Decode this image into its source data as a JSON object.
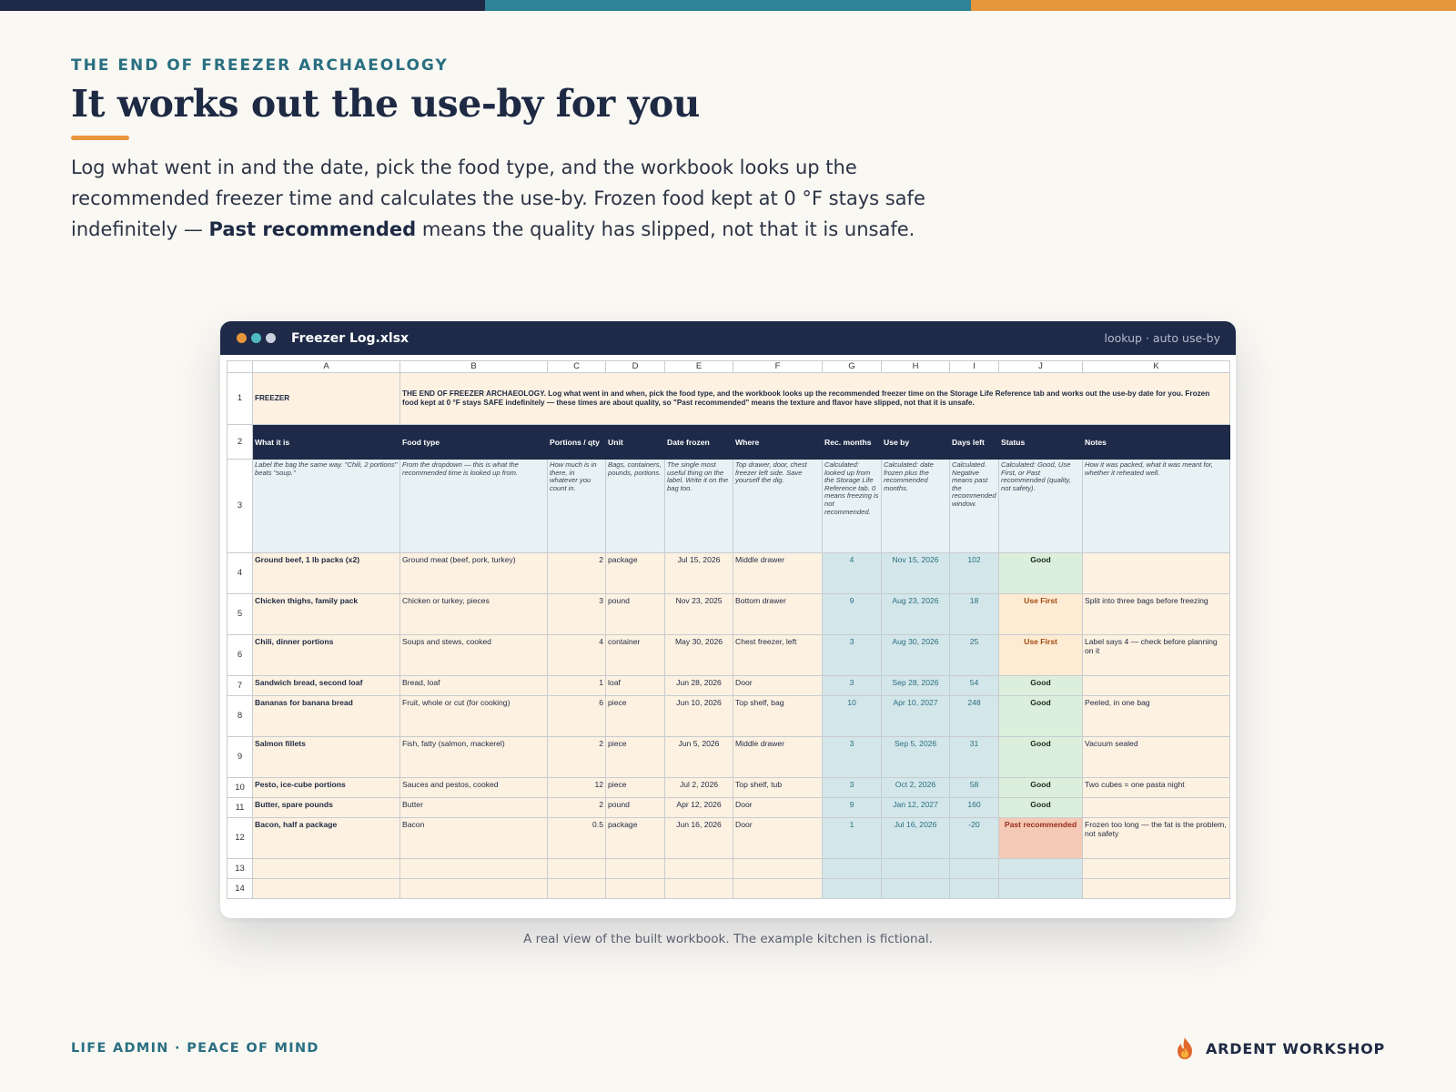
{
  "colors": {
    "navy": "#1e2a48",
    "teal": "#2a6f82",
    "orange": "#e8963c",
    "input_fill": "#fdf1e1",
    "calc_fill": "#d3e6e9",
    "good_fill": "#dcefdc",
    "use_first_fill": "#fdebd3",
    "past_fill": "#f4c9b6",
    "bg": "#faf8f3"
  },
  "eyebrow": "THE END OF FREEZER ARCHAEOLOGY",
  "headline": "It works out the use-by for you",
  "lede": {
    "part1": "Log what went in and the date, pick the food type, and the workbook looks up the recommended freezer time and calculates the use-by. Frozen food kept at 0 °F stays safe indefinitely — ",
    "bold": "Past recommended",
    "part2": " means the quality has slipped, not that it is unsafe."
  },
  "window": {
    "title": "Freezer Log.xlsx",
    "right_label": "lookup · auto use-by",
    "dots": [
      "#e8963c",
      "#4fb8c2",
      "#c9cfdc"
    ]
  },
  "sheet": {
    "columns": [
      "A",
      "B",
      "C",
      "D",
      "E",
      "F",
      "G",
      "H",
      "I",
      "J",
      "K"
    ],
    "row_numbers": [
      "1",
      "2",
      "3",
      "4",
      "5",
      "6",
      "7",
      "8",
      "9",
      "10",
      "11",
      "12",
      "13",
      "14"
    ],
    "title_cell": "FREEZER",
    "description": "THE END OF FREEZER ARCHAEOLOGY. Log what went in and when, pick the food type, and the workbook looks up the recommended freezer time on the Storage Life Reference tab and works out the use-by date for you. Frozen food kept at 0 °F stays SAFE indefinitely — these times are about quality, so \"Past recommended\" means the texture and flavor have slipped, not that it is unsafe.",
    "headers": [
      "What it is",
      "Food type",
      "Portions / qty",
      "Unit",
      "Date frozen",
      "Where",
      "Rec. months",
      "Use by",
      "Days left",
      "Status",
      "Notes"
    ],
    "hints": [
      "Label the bag the same way. \"Chili, 2 portions\" beats \"soup.\"",
      "From the dropdown — this is what the recommended time is looked up from.",
      "How much is in there, in whatever you count in.",
      "Bags, containers, pounds, portions.",
      "The single most useful thing on the label. Write it on the bag too.",
      "Top drawer, door, chest freezer left side. Save yourself the dig.",
      "Calculated: looked up from the Storage Life Reference tab. 0 means freezing is not recommended.",
      "Calculated: date frozen plus the recommended months.",
      "Calculated. Negative means past the recommended window.",
      "Calculated: Good, Use First, or Past recommended (quality, not safety).",
      "How it was packed, what it was meant for, whether it reheated well."
    ],
    "rows": [
      {
        "what": "Ground beef, 1 lb packs (x2)",
        "food_type": "Ground meat (beef, pork, turkey)",
        "qty": "2",
        "unit": "package",
        "date_frozen": "Jul 15, 2026",
        "where": "Middle drawer",
        "rec_months": "4",
        "use_by": "Nov 15, 2026",
        "days_left": "102",
        "status": "Good",
        "status_kind": "good",
        "notes": ""
      },
      {
        "what": "Chicken thighs, family pack",
        "food_type": "Chicken or turkey, pieces",
        "qty": "3",
        "unit": "pound",
        "date_frozen": "Nov 23, 2025",
        "where": "Bottom drawer",
        "rec_months": "9",
        "use_by": "Aug 23, 2026",
        "days_left": "18",
        "status": "Use First",
        "status_kind": "use",
        "notes": "Split into three bags before freezing"
      },
      {
        "what": "Chili, dinner portions",
        "food_type": "Soups and stews, cooked",
        "qty": "4",
        "unit": "container",
        "date_frozen": "May 30, 2026",
        "where": "Chest freezer, left",
        "rec_months": "3",
        "use_by": "Aug 30, 2026",
        "days_left": "25",
        "status": "Use First",
        "status_kind": "use",
        "notes": "Label says 4 — check before planning on it"
      },
      {
        "what": "Sandwich bread, second loaf",
        "food_type": "Bread, loaf",
        "qty": "1",
        "unit": "loaf",
        "date_frozen": "Jun 28, 2026",
        "where": "Door",
        "rec_months": "3",
        "use_by": "Sep 28, 2026",
        "days_left": "54",
        "status": "Good",
        "status_kind": "good",
        "notes": ""
      },
      {
        "what": "Bananas for banana bread",
        "food_type": "Fruit, whole or cut (for cooking)",
        "qty": "6",
        "unit": "piece",
        "date_frozen": "Jun 10, 2026",
        "where": "Top shelf, bag",
        "rec_months": "10",
        "use_by": "Apr 10, 2027",
        "days_left": "248",
        "status": "Good",
        "status_kind": "good",
        "notes": "Peeled, in one bag"
      },
      {
        "what": "Salmon fillets",
        "food_type": "Fish, fatty (salmon, mackerel)",
        "qty": "2",
        "unit": "piece",
        "date_frozen": "Jun 5, 2026",
        "where": "Middle drawer",
        "rec_months": "3",
        "use_by": "Sep 5, 2026",
        "days_left": "31",
        "status": "Good",
        "status_kind": "good",
        "notes": "Vacuum sealed"
      },
      {
        "what": "Pesto, ice-cube portions",
        "food_type": "Sauces and pestos, cooked",
        "qty": "12",
        "unit": "piece",
        "date_frozen": "Jul 2, 2026",
        "where": "Top shelf, tub",
        "rec_months": "3",
        "use_by": "Oct 2, 2026",
        "days_left": "58",
        "status": "Good",
        "status_kind": "good",
        "notes": "Two cubes = one pasta night"
      },
      {
        "what": "Butter, spare pounds",
        "food_type": "Butter",
        "qty": "2",
        "unit": "pound",
        "date_frozen": "Apr 12, 2026",
        "where": "Door",
        "rec_months": "9",
        "use_by": "Jan 12, 2027",
        "days_left": "160",
        "status": "Good",
        "status_kind": "good",
        "notes": ""
      },
      {
        "what": "Bacon, half a package",
        "food_type": "Bacon",
        "qty": "0.5",
        "unit": "package",
        "date_frozen": "Jun 16, 2026",
        "where": "Door",
        "rec_months": "1",
        "use_by": "Jul 16, 2026",
        "days_left": "-20",
        "status": "Past recommended",
        "status_kind": "past",
        "notes": "Frozen too long — the fat is the problem, not safety"
      },
      {
        "what": "",
        "food_type": "",
        "qty": "",
        "unit": "",
        "date_frozen": "",
        "where": "",
        "rec_months": "",
        "use_by": "",
        "days_left": "",
        "status": "",
        "status_kind": "empty",
        "notes": ""
      },
      {
        "what": "",
        "food_type": "",
        "qty": "",
        "unit": "",
        "date_frozen": "",
        "where": "",
        "rec_months": "",
        "use_by": "",
        "days_left": "",
        "status": "",
        "status_kind": "empty",
        "notes": ""
      }
    ]
  },
  "caption": "A real view of the built workbook. The example kitchen is fictional.",
  "footer": {
    "left": "LIFE ADMIN · PEACE OF MIND",
    "brand": "ARDENT WORKSHOP",
    "brand_icon": "flame-icon"
  }
}
